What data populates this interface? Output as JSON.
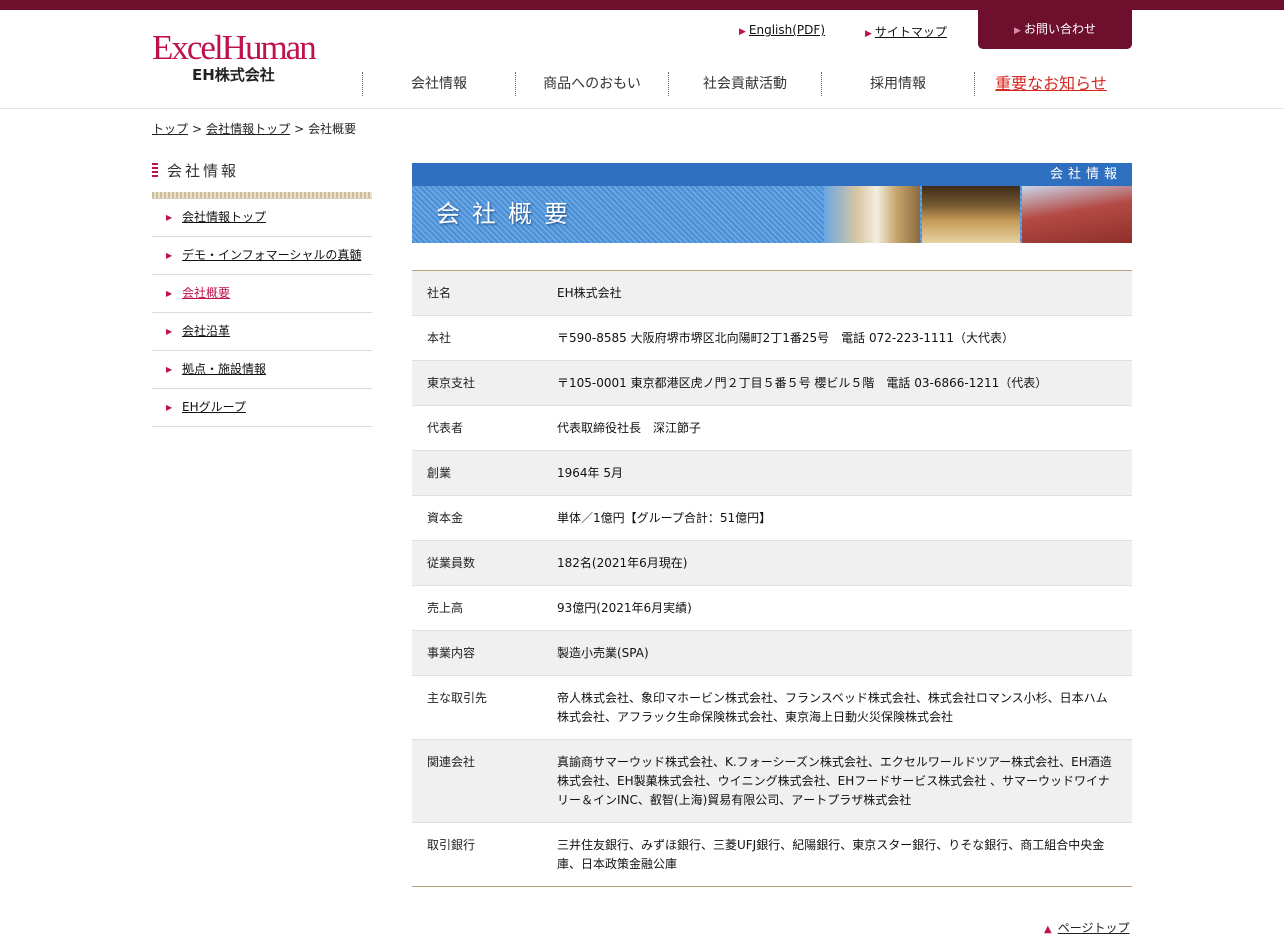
{
  "brand": {
    "logo_main": "ExcelHuman",
    "logo_sub": "EH株式会社",
    "accent": "#c0114f",
    "dark": "#6e0f2d"
  },
  "util_nav": [
    {
      "label": "English(PDF)"
    },
    {
      "label": "サイトマップ"
    },
    {
      "label": "お問い合わせ"
    }
  ],
  "global_nav": [
    {
      "label": "会社情報"
    },
    {
      "label": "商品へのおもい"
    },
    {
      "label": "社会貢献活動"
    },
    {
      "label": "採用情報"
    },
    {
      "label": "重要なお知らせ"
    }
  ],
  "breadcrumb": [
    {
      "label": "トップ"
    },
    {
      "label": "会社情報トップ"
    },
    {
      "label": "会社概要"
    }
  ],
  "sidebar": {
    "title": "会社情報",
    "items": [
      {
        "label": "会社情報トップ"
      },
      {
        "label": "デモ・インフォマーシャルの真髄"
      },
      {
        "label": "会社概要"
      },
      {
        "label": "会社沿革"
      },
      {
        "label": "拠点・施設情報"
      },
      {
        "label": "EHグループ"
      }
    ]
  },
  "banner": {
    "section": "会社情報",
    "title": "会社概要"
  },
  "company_info": [
    {
      "label": "社名",
      "value": "EH株式会社"
    },
    {
      "label": "本社",
      "value": "〒590-8585 大阪府堺市堺区北向陽町2丁1番25号　電話 072-223-1111（大代表）"
    },
    {
      "label": "東京支社",
      "value": "〒105-0001 東京都港区虎ノ門２丁目５番５号 櫻ビル５階　電話 03-6866-1211（代表）"
    },
    {
      "label": "代表者",
      "value": "代表取締役社長　深江節子"
    },
    {
      "label": "創業",
      "value": "1964年 5月"
    },
    {
      "label": "資本金",
      "value": "単体／1億円【グループ合計：51億円】"
    },
    {
      "label": "従業員数",
      "value": "182名(2021年6月現在)"
    },
    {
      "label": "売上高",
      "value": "93億円(2021年6月実績)"
    },
    {
      "label": "事業内容",
      "value": "製造小売業(SPA)"
    },
    {
      "label": "主な取引先",
      "value": "帝人株式会社、象印マホービン株式会社、フランスベッド株式会社、株式会社ロマンス小杉、日本ハム株式会社、アフラック生命保険株式会社、東京海上日動火災保険株式会社"
    },
    {
      "label": "関連会社",
      "value": "真諭商サマーウッド株式会社、K.フォーシーズン株式会社、エクセルワールドツアー株式会社、EH酒造株式会社、EH製菓株式会社、ウイニング株式会社、EHフードサービス株式会社 、サマーウッドワイナリー＆インINC、叡智(上海)貿易有限公司、アートプラザ株式会社"
    },
    {
      "label": "取引銀行",
      "value": "三井住友銀行、みずほ銀行、三菱UFJ銀行、紀陽銀行、東京スター銀行、りそな銀行、商工組合中央金庫、日本政策金融公庫"
    }
  ],
  "page_top": {
    "label": "ページトップ"
  }
}
